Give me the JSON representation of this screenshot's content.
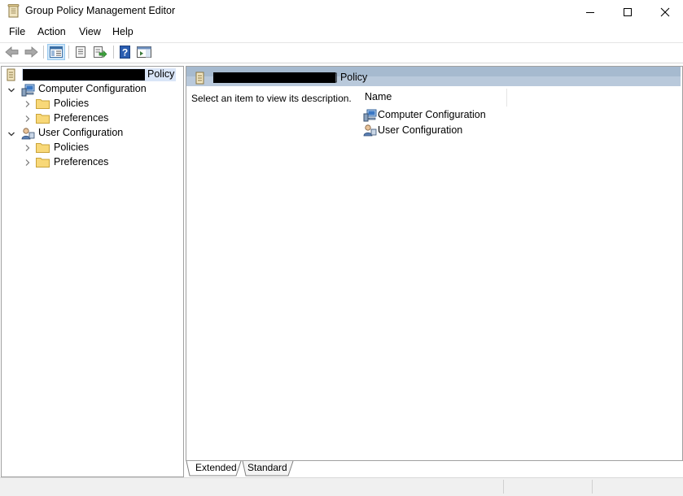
{
  "window": {
    "title": "Group Policy Management Editor",
    "icon": "policy-scroll-icon"
  },
  "menu": {
    "file": "File",
    "action": "Action",
    "view": "View",
    "help": "Help"
  },
  "toolbar": {
    "icons": [
      "back-arrow-icon",
      "forward-arrow-icon",
      "show-hide-tree-icon",
      "properties-icon",
      "export-list-icon",
      "help-icon",
      "show-action-pane-icon"
    ]
  },
  "tree": {
    "root": {
      "label_suffix": "Policy",
      "icon": "policy-scroll-icon"
    },
    "nodes": [
      {
        "label": "Computer Configuration",
        "icon": "computer-config-icon",
        "children": [
          {
            "label": "Policies",
            "icon": "folder-icon"
          },
          {
            "label": "Preferences",
            "icon": "folder-icon"
          }
        ]
      },
      {
        "label": "User Configuration",
        "icon": "user-config-icon",
        "children": [
          {
            "label": "Policies",
            "icon": "folder-icon"
          },
          {
            "label": "Preferences",
            "icon": "folder-icon"
          }
        ]
      }
    ]
  },
  "details": {
    "header_suffix": "] Policy",
    "description": "Select an item to view its description.",
    "column_name": "Name",
    "items": [
      {
        "label": "Computer Configuration",
        "icon": "computer-config-icon"
      },
      {
        "label": "User Configuration",
        "icon": "user-config-icon"
      }
    ]
  },
  "tabs": {
    "extended": "Extended",
    "standard": "Standard",
    "selected": "Extended"
  },
  "colors": {
    "header_blue": "#b9c9db",
    "selection": "#d9e5f7",
    "border": "#a0a0a0"
  }
}
